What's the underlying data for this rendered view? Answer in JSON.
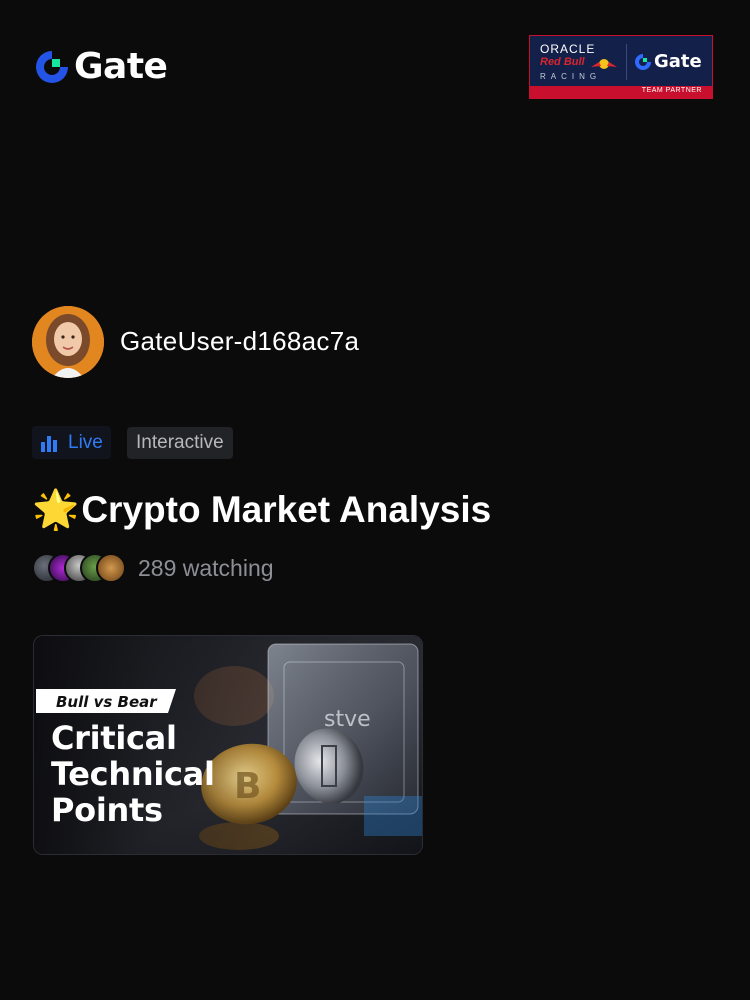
{
  "header": {
    "logo_text": "Gate",
    "partner": {
      "oracle": "ORACLE",
      "redbull": "Red Bull",
      "racing": "RACING",
      "gate": "Gate",
      "team_partner": "TEAM PARTNER"
    }
  },
  "host": {
    "username": "GateUser-d168ac7a"
  },
  "tags": {
    "live_label": "Live",
    "interactive_label": "Interactive"
  },
  "stream": {
    "emoji": "🌟",
    "title": "Crypto Market Analysis",
    "watching": "289 watching"
  },
  "thumbnail": {
    "badge": "Bull vs Bear",
    "headline_lines": [
      "Critical",
      "Technical",
      "Points"
    ],
    "box_text": "stve"
  },
  "colors": {
    "accent_blue": "#2f7bf5",
    "logo_green": "#17e6a1",
    "partner_navy": "#13204a",
    "partner_red": "#c8102e"
  }
}
